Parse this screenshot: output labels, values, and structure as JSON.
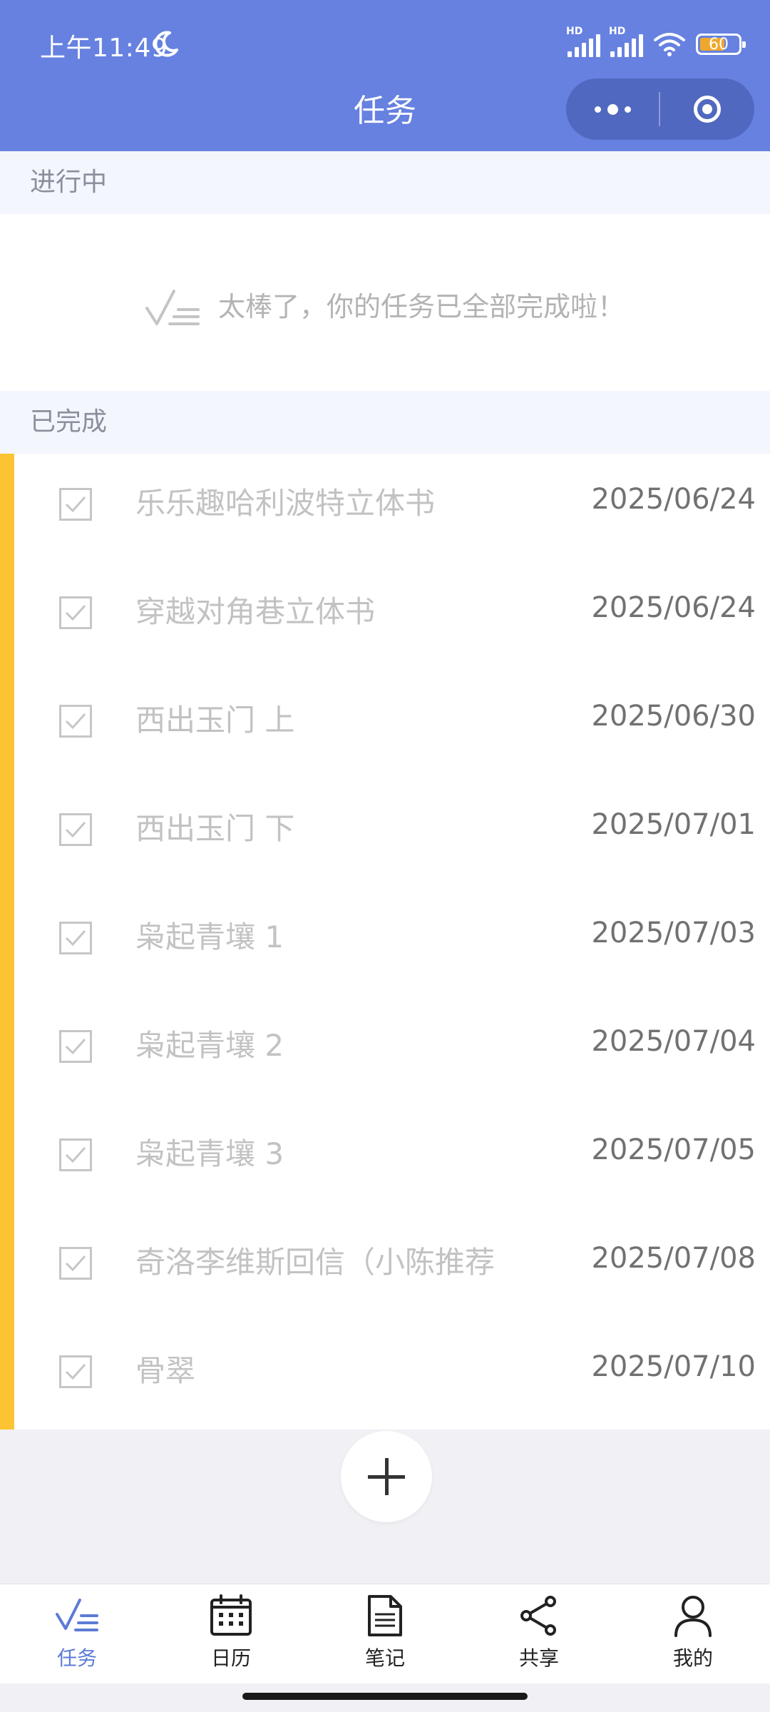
{
  "status_bar": {
    "time": "上午11:49",
    "signal_labels": [
      "HD",
      "HD"
    ],
    "battery_level": "60"
  },
  "header": {
    "title": "任务"
  },
  "sections": {
    "in_progress": {
      "title": "进行中",
      "empty_message": "太棒了，你的任务已全部完成啦！"
    },
    "completed": {
      "title": "已完成"
    }
  },
  "completed_tasks": [
    {
      "title": "乐乐趣哈利波特立体书",
      "date": "2025/06/24"
    },
    {
      "title": "穿越对角巷立体书",
      "date": "2025/06/24"
    },
    {
      "title": "西出玉门 上",
      "date": "2025/06/30"
    },
    {
      "title": "西出玉门 下",
      "date": "2025/07/01"
    },
    {
      "title": "枭起青壤 1",
      "date": "2025/07/03"
    },
    {
      "title": "枭起青壤 2",
      "date": "2025/07/04"
    },
    {
      "title": "枭起青壤 3",
      "date": "2025/07/05"
    },
    {
      "title": "奇洛李维斯回信（小陈推荐",
      "date": "2025/07/08"
    },
    {
      "title": "骨翠",
      "date": "2025/07/10"
    }
  ],
  "tabbar": {
    "items": [
      {
        "label": "任务",
        "icon": "tasks-icon",
        "active": true
      },
      {
        "label": "日历",
        "icon": "calendar-icon",
        "active": false
      },
      {
        "label": "笔记",
        "icon": "note-icon",
        "active": false
      },
      {
        "label": "共享",
        "icon": "share-icon",
        "active": false
      },
      {
        "label": "我的",
        "icon": "user-icon",
        "active": false
      }
    ]
  },
  "colors": {
    "header_bg": "#6681e0",
    "accent_bar": "#fcc432",
    "active_tab": "#5d7bd6"
  }
}
